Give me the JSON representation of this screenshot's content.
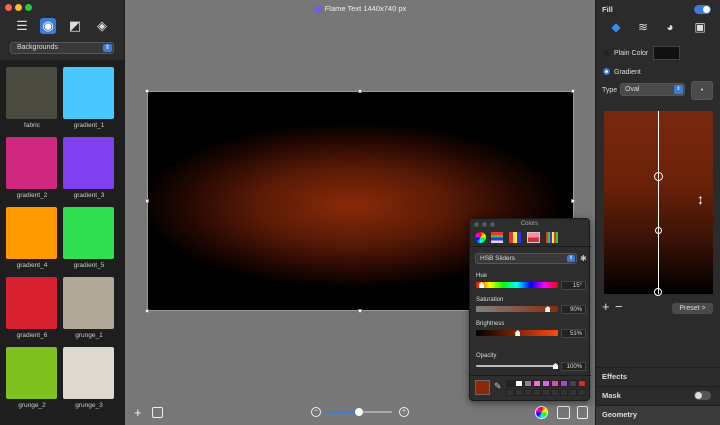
{
  "window": {
    "title": "Flame Text 1440x740 px"
  },
  "left_panel": {
    "category": "Backgrounds",
    "items": [
      {
        "label": "fabric",
        "color": "#4a4a40"
      },
      {
        "label": "gradient_1",
        "color": "#48c8ff"
      },
      {
        "label": "gradient_2",
        "color": "#d02880"
      },
      {
        "label": "gradient_3",
        "color": "#8040f0"
      },
      {
        "label": "gradient_4",
        "color": "#ff9a00"
      },
      {
        "label": "gradient_5",
        "color": "#30e050"
      },
      {
        "label": "gradient_6",
        "color": "#d82030"
      },
      {
        "label": "grunge_1",
        "color": "#b0a898"
      },
      {
        "label": "grunge_2",
        "color": "#80c020"
      },
      {
        "label": "grunge_3",
        "color": "#dedad0"
      }
    ]
  },
  "right_panel": {
    "fill": {
      "title": "Fill",
      "plain_color": "Plain Color",
      "gradient": "Gradient",
      "type_label": "Type",
      "type_value": "Oval",
      "preset": "Preset",
      "preset_chevron": ">",
      "add": "+",
      "remove": "−"
    },
    "sections": {
      "effects": "Effects",
      "mask": "Mask",
      "geometry": "Geometry"
    }
  },
  "colors_panel": {
    "title": "Colors",
    "mode": "HSB Sliders",
    "hue_label": "Hue",
    "hue_value": "15°",
    "saturation_label": "Saturation",
    "saturation_value": "90%",
    "brightness_label": "Brightness",
    "brightness_value": "51%",
    "opacity_label": "Opacity",
    "opacity_value": "100%",
    "levels": {
      "hue": 0.04,
      "saturation": 0.9,
      "brightness": 0.51,
      "opacity": 1.0
    },
    "current_color": "#8a2a08",
    "swatches": [
      "#222222",
      "#ffffff",
      "#888888",
      "#ff66cc",
      "#cc66ff",
      "#ee44aa",
      "#aa44dd",
      "#444444",
      "#ee2222",
      "#333333",
      "#333333",
      "#333333",
      "#333333",
      "#333333",
      "#333333",
      "#333333",
      "#333333",
      "#333333"
    ]
  },
  "toolbar": {
    "zoom_level": 0.5
  }
}
